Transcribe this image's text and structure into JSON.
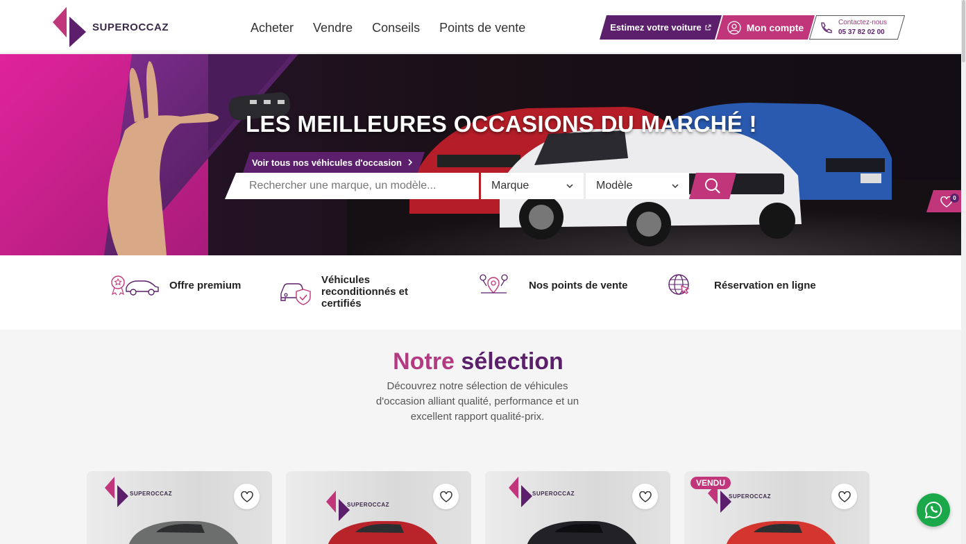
{
  "header": {
    "logo_text": "SUPEROCCAZ",
    "nav": [
      "Acheter",
      "Vendre",
      "Conseils",
      "Points de vente"
    ],
    "estimate_label": "Estimez votre voiture",
    "account_label": "Mon compte",
    "contact_label": "Contactez-nous",
    "contact_phone": "05 37 82 02 00"
  },
  "hero": {
    "title": "LES MEILLEURES OCCASIONS DU MARCHÉ !",
    "link_label": "Voir tous nos véhicules d'occasion",
    "search_placeholder": "Rechercher une marque, un modèle...",
    "select_brand": "Marque",
    "select_model": "Modèle",
    "favorites_count": "0"
  },
  "features": [
    {
      "label": "Offre premium",
      "icon": "premium-car-icon"
    },
    {
      "label": "Véhicules reconditionnés et certifiés",
      "icon": "certified-car-icon"
    },
    {
      "label": "Nos points de vente",
      "icon": "locations-icon"
    },
    {
      "label": "Réservation en ligne",
      "icon": "globe-cursor-icon"
    }
  ],
  "selection": {
    "title_part1": "Notre",
    "title_part2": "sélection",
    "description": "Découvrez notre sélection de véhicules d'occasion alliant qualité, performance et un excellent rapport qualité-prix."
  },
  "cards": [
    {
      "brand": "SUPEROCCAZ",
      "car_color": "#6b6e6c",
      "sold": false
    },
    {
      "brand": "SUPEROCCAZ",
      "car_color": "#b8242a",
      "sold": false
    },
    {
      "brand": "SUPEROCCAZ",
      "car_color": "#222226",
      "sold": false
    },
    {
      "brand": "SUPEROCCAZ",
      "car_color": "#d4352e",
      "sold": true,
      "sold_label": "VENDU"
    }
  ],
  "colors": {
    "primary": "#5b1f6b",
    "accent": "#c1357a",
    "whatsapp": "#1aa84a"
  }
}
